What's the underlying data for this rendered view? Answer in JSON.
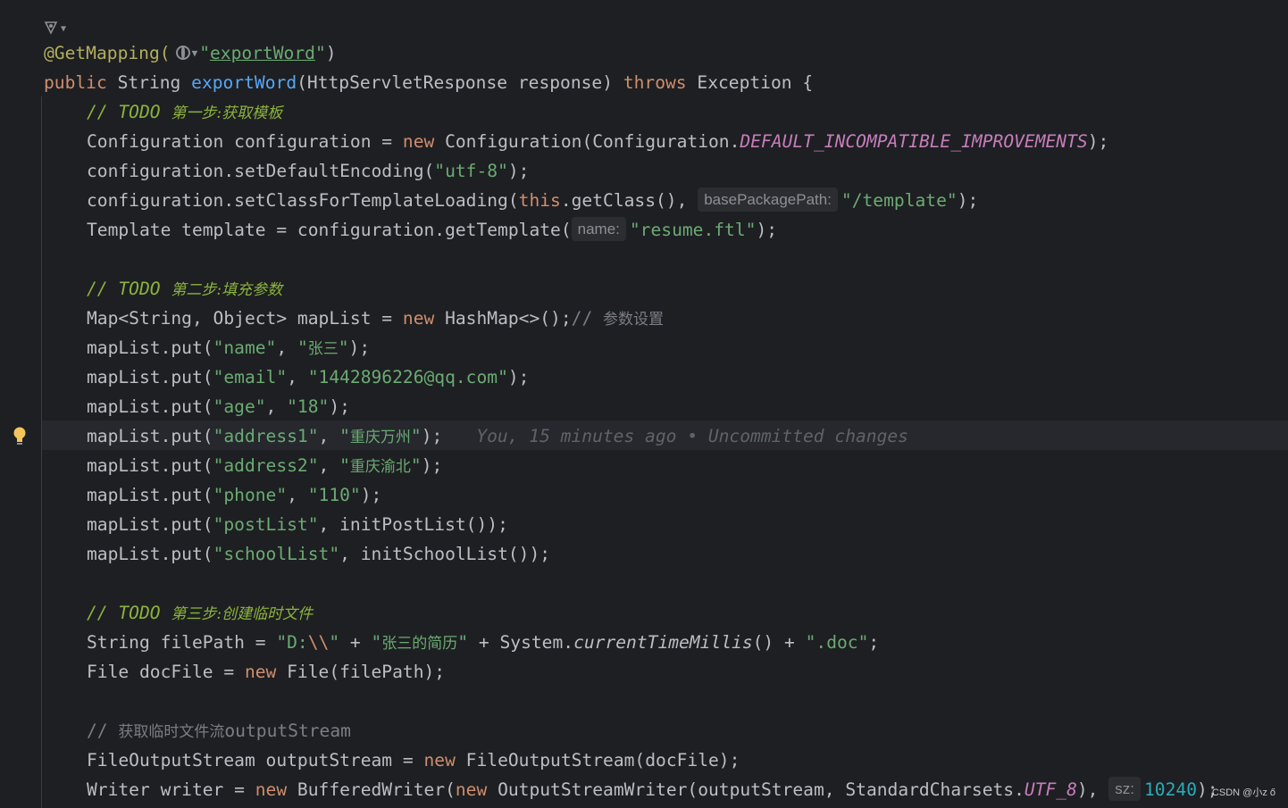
{
  "gutter": {
    "icon": "bean-method-icon",
    "bulb_icon": "lightbulb-icon"
  },
  "code": {
    "l1_annotation": "@GetMapping(",
    "l1_globe_icon": "globe-icon",
    "l1_string_q": "\"",
    "l1_string": "exportWord",
    "l1_close": ")",
    "l2_public": "public",
    "l2_type": " String ",
    "l2_method": "exportWord",
    "l2_params": "(HttpServletResponse response) ",
    "l2_throws": "throws",
    "l2_rest": " Exception {",
    "l3_prefix": "// ",
    "l3_todo": "TODO ",
    "l3_cn": "第一步:获取模板",
    "l4_a": "Configuration configuration = ",
    "l4_new": "new",
    "l4_b": " Configuration(Configuration.",
    "l4_const": "DEFAULT_INCOMPATIBLE_IMPROVEMENTS",
    "l4_c": ");",
    "l5_a": "configuration.setDefaultEncoding(",
    "l5_str": "\"utf-8\"",
    "l5_c": ");",
    "l6_a": "configuration.setClassForTemplateLoading(",
    "l6_this": "this",
    "l6_b": ".getClass(), ",
    "l6_hint": "basePackagePath:",
    "l6_str": "\"/template\"",
    "l6_c": ");",
    "l7_a": "Template template = configuration.getTemplate(",
    "l7_hint": "name:",
    "l7_str": "\"resume.ftl\"",
    "l7_c": ");",
    "l9_prefix": "// ",
    "l9_todo": "TODO ",
    "l9_cn": "第二步:填充参数",
    "l10_a": "Map<String, Object> mapList = ",
    "l10_new": "new",
    "l10_b": " HashMap<>();",
    "l10_cm": "// ",
    "l10_cn": "参数设置",
    "put": "mapList.put(",
    "l11_k": "\"name\"",
    "l11_v1": "\"",
    "l11_vcn": "张三",
    "l11_v2": "\"",
    "l12_k": "\"email\"",
    "l12_v": "\"1442896226@qq.com\"",
    "l13_k": "\"age\"",
    "l13_v": "\"18\"",
    "l14_k": "\"address1\"",
    "l14_vcn": "重庆万州",
    "l14_blame": "You, 15 minutes ago • Uncommitted changes",
    "l15_k": "\"address2\"",
    "l15_vcn": "重庆渝北",
    "l16_k": "\"phone\"",
    "l16_v": "\"110\"",
    "l17_k": "\"postList\"",
    "l17_v": "initPostList()",
    "l18_k": "\"schoolList\"",
    "l18_v": "initSchoolList()",
    "l20_prefix": "// ",
    "l20_todo": "TODO ",
    "l20_cn": "第三步:创建临时文件",
    "l21_a": "String filePath = ",
    "l21_s1": "\"D:",
    "l21_esc": "\\\\",
    "l21_s1e": "\"",
    "l21_plus": " + ",
    "l21_s2cn": "张三的简历",
    "l21_b": " + System.",
    "l21_static": "currentTimeMillis",
    "l21_c": "() + ",
    "l21_s3": "\".doc\"",
    "l21_end": ";",
    "l22_a": "File docFile = ",
    "l22_new": "new",
    "l22_b": " File(filePath);",
    "l24_prefix": "// ",
    "l24_cn": "获取临时文件流",
    "l24_rest": "outputStream",
    "l25_a": "FileOutputStream outputStream = ",
    "l25_new": "new",
    "l25_b": " FileOutputStream(docFile);",
    "l26_a": "Writer writer = ",
    "l26_new": "new",
    "l26_b": " BufferedWriter(",
    "l26_new2": "new",
    "l26_c": " OutputStreamWriter(outputStream, StandardCharsets.",
    "l26_const": "UTF_8",
    "l26_d": "), ",
    "l26_hint": "sz:",
    "l26_num": "10240",
    "l26_e": ");"
  },
  "watermark": "CSDN @小z ő"
}
